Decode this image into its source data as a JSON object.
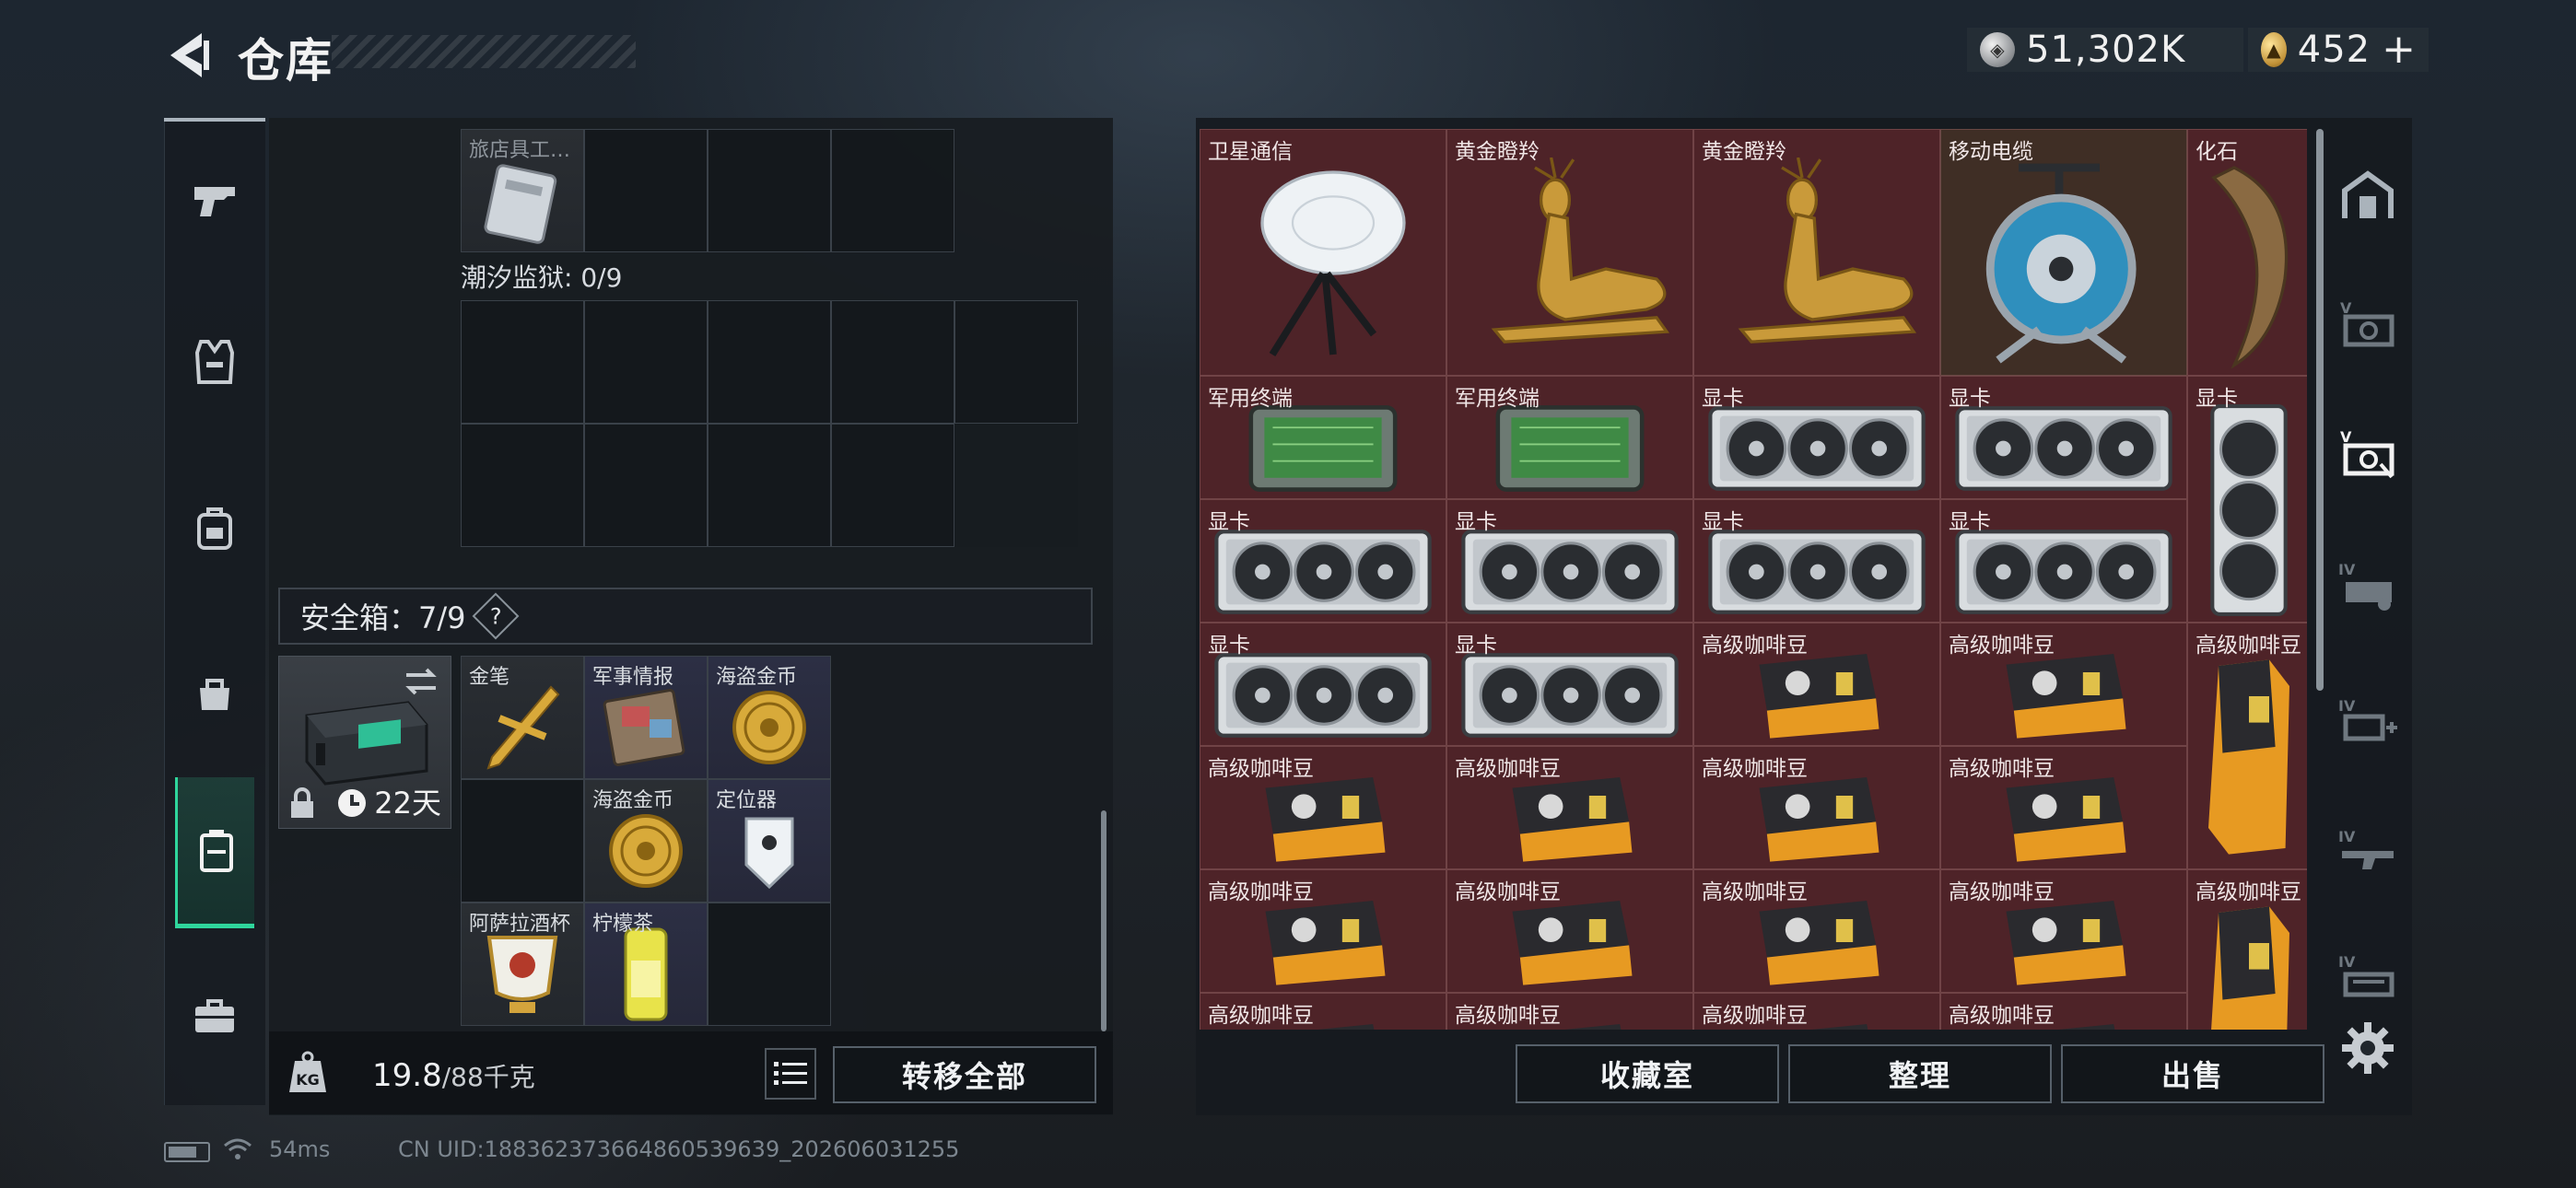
{
  "header": {
    "title": "仓库",
    "currencies": [
      {
        "icon": "silver-coin-icon",
        "value": "51,302K"
      },
      {
        "icon": "gold-coin-icon",
        "value": "452"
      }
    ],
    "plus_label": "+"
  },
  "left_nav": {
    "items": [
      {
        "icon": "pistol-icon"
      },
      {
        "icon": "vest-icon"
      },
      {
        "icon": "backpack-icon"
      },
      {
        "icon": "bag-icon"
      },
      {
        "icon": "safe-box-icon",
        "active": true
      },
      {
        "icon": "briefcase-icon"
      }
    ]
  },
  "left_panel": {
    "top_item_label": "旅店具工…",
    "prison_section": "潮汐监狱: 0/9",
    "safe_section": {
      "label": "安全箱：7/9",
      "help": "?"
    },
    "safe_box": {
      "days": "22天"
    },
    "safe_items": [
      {
        "label": "金笔",
        "art": "pen"
      },
      {
        "label": "军事情报",
        "art": "intel"
      },
      {
        "label": "海盗金币",
        "art": "coin"
      },
      {
        "label": "海盗金币",
        "art": "coin"
      },
      {
        "label": "定位器",
        "art": "tracker"
      },
      {
        "label": "阿萨拉酒杯",
        "art": "cup"
      },
      {
        "label": "柠檬茶",
        "art": "can"
      }
    ],
    "weight": {
      "current": "19.8",
      "max": "/88千克"
    },
    "transfer_button": "转移全部"
  },
  "stash": {
    "items": [
      {
        "label": "卫星通信",
        "art": "dish"
      },
      {
        "label": "黄金瞪羚",
        "art": "deer"
      },
      {
        "label": "黄金瞪羚",
        "art": "deer"
      },
      {
        "label": "移动电缆",
        "art": "reel"
      },
      {
        "label": "化石",
        "art": "claw"
      },
      {
        "label": "军用终端",
        "art": "terminal"
      },
      {
        "label": "军用终端",
        "art": "terminal"
      },
      {
        "label": "显卡",
        "art": "gpu"
      },
      {
        "label": "显卡",
        "art": "gpu"
      },
      {
        "label": "显卡",
        "art": "gpu-v"
      },
      {
        "label": "显卡",
        "art": "gpu"
      },
      {
        "label": "显卡",
        "art": "gpu"
      },
      {
        "label": "显卡",
        "art": "gpu"
      },
      {
        "label": "显卡",
        "art": "gpu"
      },
      {
        "label": "显卡",
        "art": "gpu"
      },
      {
        "label": "显卡",
        "art": "gpu"
      },
      {
        "label": "高级咖啡豆",
        "art": "coffee"
      },
      {
        "label": "高级咖啡豆",
        "art": "coffee"
      },
      {
        "label": "高级咖啡豆",
        "art": "coffee-v"
      },
      {
        "label": "高级咖啡豆",
        "art": "coffee"
      },
      {
        "label": "高级咖啡豆",
        "art": "coffee"
      },
      {
        "label": "高级咖啡豆",
        "art": "coffee"
      },
      {
        "label": "高级咖啡豆",
        "art": "coffee"
      },
      {
        "label": "高级咖啡豆",
        "art": "coffee"
      },
      {
        "label": "高级咖啡豆",
        "art": "coffee"
      },
      {
        "label": "高级咖啡豆",
        "art": "coffee"
      },
      {
        "label": "高级咖啡豆",
        "art": "coffee"
      },
      {
        "label": "高级咖啡豆",
        "art": "coffee-v"
      },
      {
        "label": "高级咖啡豆",
        "art": "coffee"
      },
      {
        "label": "高级咖啡豆",
        "art": "coffee"
      },
      {
        "label": "高级咖啡豆",
        "art": "coffee"
      },
      {
        "label": "高级咖啡豆",
        "art": "coffee"
      }
    ],
    "buttons": {
      "collection": "收藏室",
      "sort": "整理",
      "sell": "出售"
    }
  },
  "right_rail": {
    "items": [
      {
        "icon": "base-icon"
      },
      {
        "icon": "tier-v-stash-icon",
        "badge": "V"
      },
      {
        "icon": "tier-v-stash-active-icon",
        "badge": "V"
      },
      {
        "icon": "tier-iv-stash-icon",
        "badge": "IV"
      },
      {
        "icon": "tier-iv-medical-icon",
        "badge": "IV"
      },
      {
        "icon": "tier-iv-weapon-icon",
        "badge": "IV"
      },
      {
        "icon": "tier-iv-ammo-icon",
        "badge": "IV"
      }
    ]
  },
  "footer": {
    "ping": "54ms",
    "uid": "CN UID:188362373664860539639_202606031255"
  },
  "colors": {
    "accent": "#2fd69c",
    "stash_cell": "#4e2328",
    "stash_cell_brown": "#3f2e25"
  }
}
